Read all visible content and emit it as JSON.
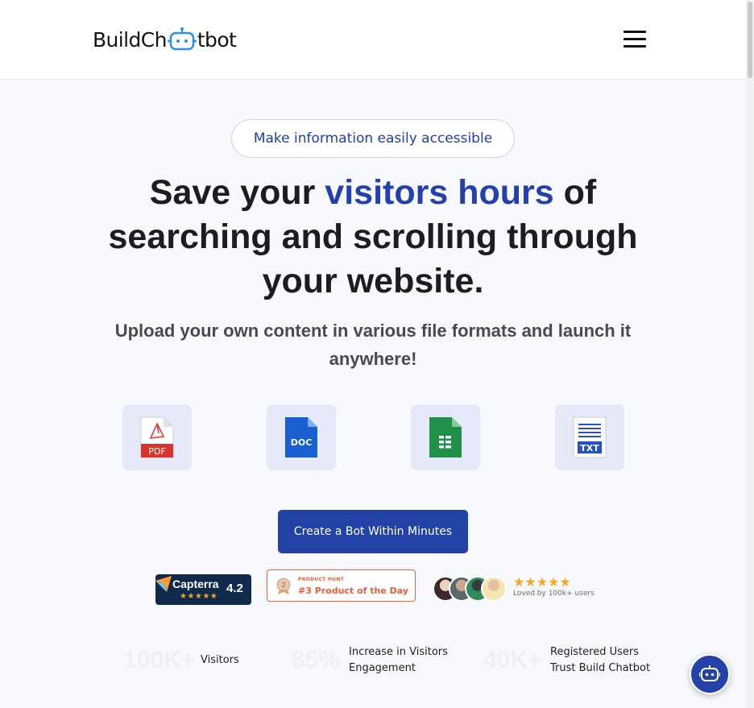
{
  "header": {
    "logo_left": "BuildCh",
    "logo_right": "tbot",
    "menu_icon": "hamburger-menu-icon"
  },
  "hero": {
    "pill": "Make information easily accessible",
    "headline_1": "Save your ",
    "headline_accent": "visitors hours",
    "headline_2": " of searching and scrolling through your website.",
    "subheadline": "Upload your own content in various file formats and launch it anywhere!"
  },
  "file_formats": [
    {
      "icon": "pdf-file-icon",
      "label": "PDF"
    },
    {
      "icon": "doc-file-icon",
      "label": "DOC"
    },
    {
      "icon": "spreadsheet-file-icon"
    },
    {
      "icon": "txt-file-icon",
      "label": "TXT"
    }
  ],
  "cta": {
    "label": "Create a Bot Within Minutes"
  },
  "badges": {
    "capterra_name": "Capterra",
    "capterra_stars": "★★★★★",
    "capterra_rating": "4.2",
    "producthunt_top": "PRODUCT HUNT",
    "producthunt_main": "#3 Product of the Day",
    "producthunt_medal": "2",
    "user_stars": "★★★★★",
    "loved_by": "Loved by 100k+ users"
  },
  "stats": [
    {
      "number": "100K+",
      "label": "Visitors"
    },
    {
      "number": "85%",
      "label_1": "Increase in Visitors",
      "label_2": "Engagement"
    },
    {
      "number": "40K+",
      "label_1": "Registered Users",
      "label_2": "Trust Build Chatbot"
    }
  ],
  "colors": {
    "accent": "#2440ad",
    "button": "#2342a6",
    "background": "#f8f9fc"
  }
}
